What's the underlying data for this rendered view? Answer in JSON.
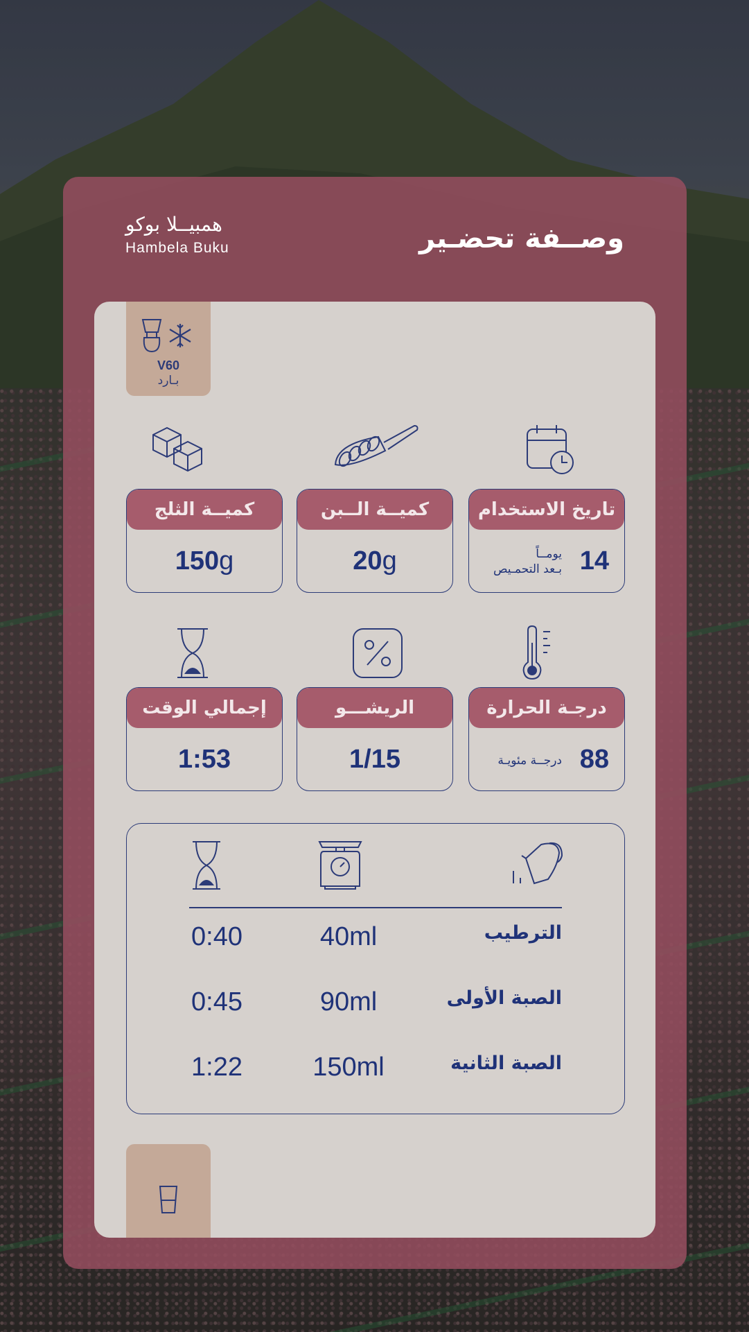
{
  "header": {
    "title": "وصــفة تحضـير",
    "coffee_name_ar": "همبيــلا بوكو",
    "coffee_name_en": "Hambela Buku"
  },
  "method_tag": {
    "method": "V60",
    "type": "بـارد",
    "icons": [
      "pour-over-icon",
      "snowflake-icon"
    ]
  },
  "stats": {
    "ice": {
      "label": "كميــة الثلج",
      "value": "150",
      "unit": "g",
      "icon": "ice-cubes-icon"
    },
    "coffee": {
      "label": "كميــة الــبن",
      "value": "20",
      "unit": "g",
      "icon": "coffee-scoop-icon"
    },
    "date": {
      "label": "تاريخ الاستخدام",
      "value": "14",
      "sub1": "يومــاً",
      "sub2": "بـعد التحمـيص",
      "icon": "calendar-icon"
    },
    "time": {
      "label": "إجمالي الوقت",
      "value": "1:53",
      "icon": "hourglass-icon"
    },
    "ratio": {
      "label": "الريشـــو",
      "value": "1/15",
      "icon": "percent-icon"
    },
    "temp": {
      "label": "درجـة الحرارة",
      "value": "88",
      "sub1": "درجــة مئويـة",
      "icon": "thermometer-icon"
    }
  },
  "pours": {
    "header_icons": [
      "hourglass-icon",
      "scale-icon",
      "kettle-icon"
    ],
    "rows": [
      {
        "stage": "الترطيب",
        "volume": "40ml",
        "time": "0:40"
      },
      {
        "stage": "الصبة الأولى",
        "volume": "90ml",
        "time": "0:45"
      },
      {
        "stage": "الصبة الثانية",
        "volume": "150ml",
        "time": "1:22"
      }
    ]
  },
  "footer_tag": {
    "icon": "cup-icon"
  },
  "colors": {
    "card": "#964e60",
    "inner": "#d6d1cd",
    "navy": "#1f3278",
    "label_bg": "#a65c6c",
    "tag_bg": "#c4a998"
  }
}
